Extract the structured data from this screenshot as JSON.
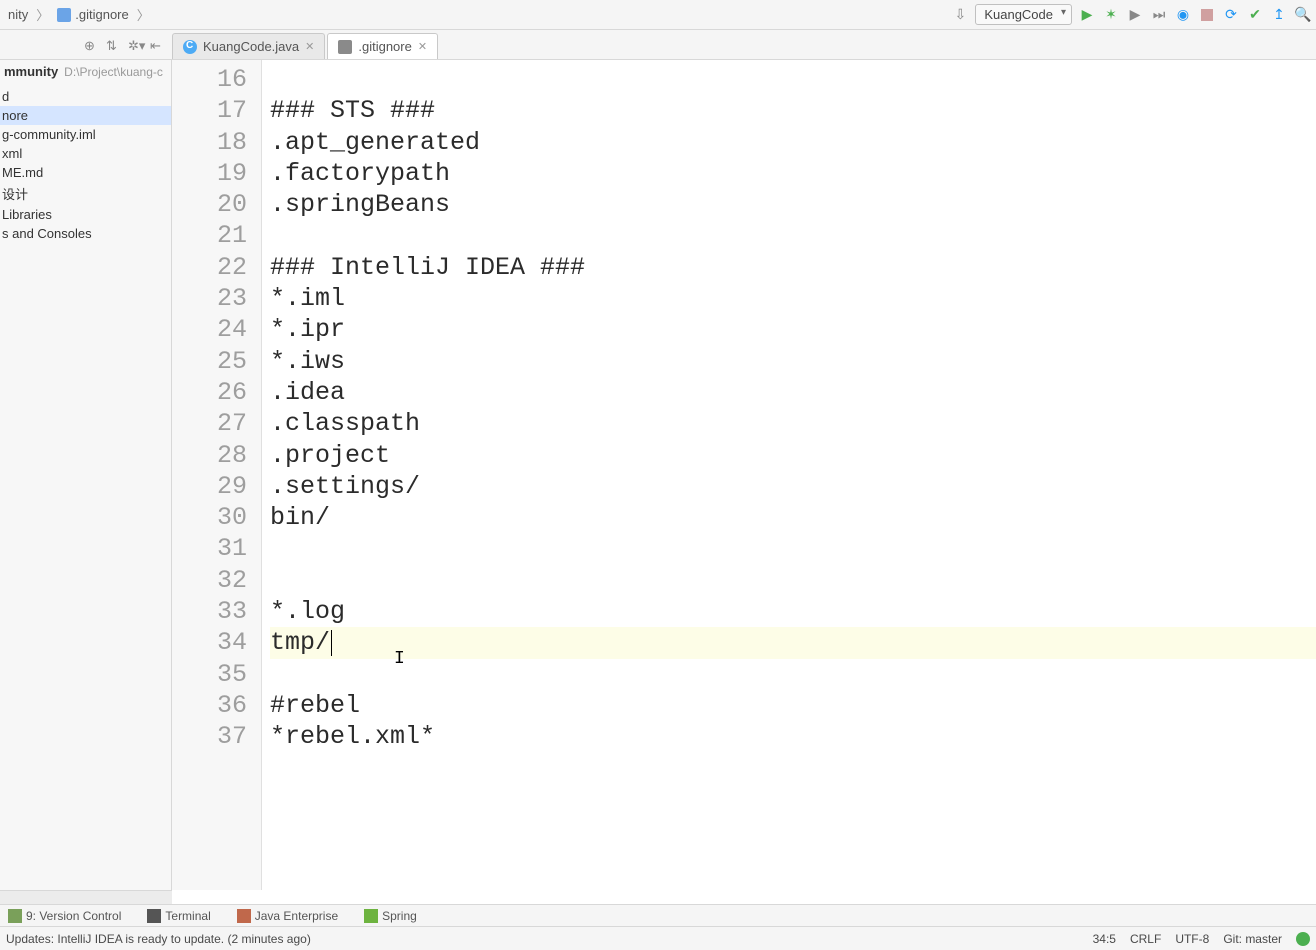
{
  "breadcrumbs": {
    "project": "nity",
    "file": ".gitignore"
  },
  "runConfig": "KuangCode",
  "tabs": [
    {
      "label": "KuangCode.java",
      "active": false
    },
    {
      "label": ".gitignore",
      "active": true
    }
  ],
  "project": {
    "name": "mmunity",
    "path": "D:\\Project\\kuang-c",
    "tree": [
      {
        "label": ""
      },
      {
        "label": "d"
      },
      {
        "label": "nore",
        "selected": true
      },
      {
        "label": "g-community.iml"
      },
      {
        "label": "xml"
      },
      {
        "label": "ME.md"
      },
      {
        "label": "设计"
      },
      {
        "label": "Libraries"
      },
      {
        "label": "s and Consoles"
      }
    ]
  },
  "editor": {
    "startLine": 16,
    "lines": [
      "",
      "### STS ###",
      ".apt_generated",
      ".factorypath",
      ".springBeans",
      "",
      "### IntelliJ IDEA ###",
      "*.iml",
      "*.ipr",
      "*.iws",
      ".idea",
      ".classpath",
      ".project",
      ".settings/",
      "bin/",
      "",
      "",
      "*.log",
      "tmp/",
      "",
      "#rebel",
      "*rebel.xml*"
    ],
    "caretLine": 34
  },
  "toolWindows": {
    "vcs": "9: Version Control",
    "term": "Terminal",
    "jee": "Java Enterprise",
    "spring": "Spring"
  },
  "status": {
    "msg": "Updates: IntelliJ IDEA is ready to update. (2 minutes ago)",
    "pos": "34:5",
    "eol": "CRLF",
    "enc": "UTF-8",
    "git": "Git: master"
  }
}
